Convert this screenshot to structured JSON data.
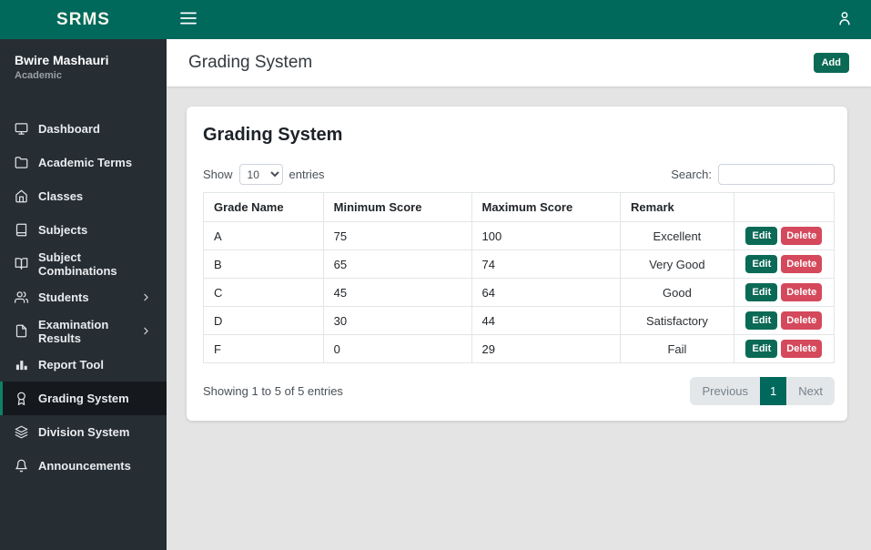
{
  "brand": "SRMS",
  "user": {
    "name": "Bwire Mashauri",
    "role": "Academic"
  },
  "sidebar": {
    "items": [
      {
        "label": "Dashboard",
        "icon": "dashboard-icon",
        "active": false,
        "has_submenu": false
      },
      {
        "label": "Academic Terms",
        "icon": "folder-icon",
        "active": false,
        "has_submenu": false
      },
      {
        "label": "Classes",
        "icon": "home-icon",
        "active": false,
        "has_submenu": false
      },
      {
        "label": "Subjects",
        "icon": "book-icon",
        "active": false,
        "has_submenu": false
      },
      {
        "label": "Subject Combinations",
        "icon": "open-book-icon",
        "active": false,
        "has_submenu": false
      },
      {
        "label": "Students",
        "icon": "users-icon",
        "active": false,
        "has_submenu": true
      },
      {
        "label": "Examination Results",
        "icon": "file-icon",
        "active": false,
        "has_submenu": true
      },
      {
        "label": "Report Tool",
        "icon": "bar-chart-icon",
        "active": false,
        "has_submenu": false
      },
      {
        "label": "Grading System",
        "icon": "award-icon",
        "active": true,
        "has_submenu": false
      },
      {
        "label": "Division System",
        "icon": "layers-icon",
        "active": false,
        "has_submenu": false
      },
      {
        "label": "Announcements",
        "icon": "bell-icon",
        "active": false,
        "has_submenu": false
      }
    ]
  },
  "page": {
    "title": "Grading System",
    "add_button": "Add"
  },
  "card": {
    "title": "Grading System",
    "length_menu": {
      "show": "Show",
      "selected": "10",
      "entries": "entries"
    },
    "search": {
      "label": "Search:",
      "value": ""
    },
    "table": {
      "headers": [
        "Grade Name",
        "Minimum Score",
        "Maximum Score",
        "Remark",
        ""
      ],
      "rows": [
        {
          "grade": "A",
          "min": "75",
          "max": "100",
          "remark": "Excellent"
        },
        {
          "grade": "B",
          "min": "65",
          "max": "74",
          "remark": "Very Good"
        },
        {
          "grade": "C",
          "min": "45",
          "max": "64",
          "remark": "Good"
        },
        {
          "grade": "D",
          "min": "30",
          "max": "44",
          "remark": "Satisfactory"
        },
        {
          "grade": "F",
          "min": "0",
          "max": "29",
          "remark": "Fail"
        }
      ],
      "actions": {
        "edit": "Edit",
        "delete": "Delete"
      }
    },
    "info": "Showing 1 to 5 of 5 entries",
    "pagination": {
      "previous": "Previous",
      "current": "1",
      "next": "Next"
    }
  },
  "colors": {
    "teal": "#00695c",
    "sidebar_bg": "#262d33",
    "sidebar_active_bg": "#15191d",
    "danger": "#d4495c",
    "content_bg": "#e4e4e4"
  }
}
